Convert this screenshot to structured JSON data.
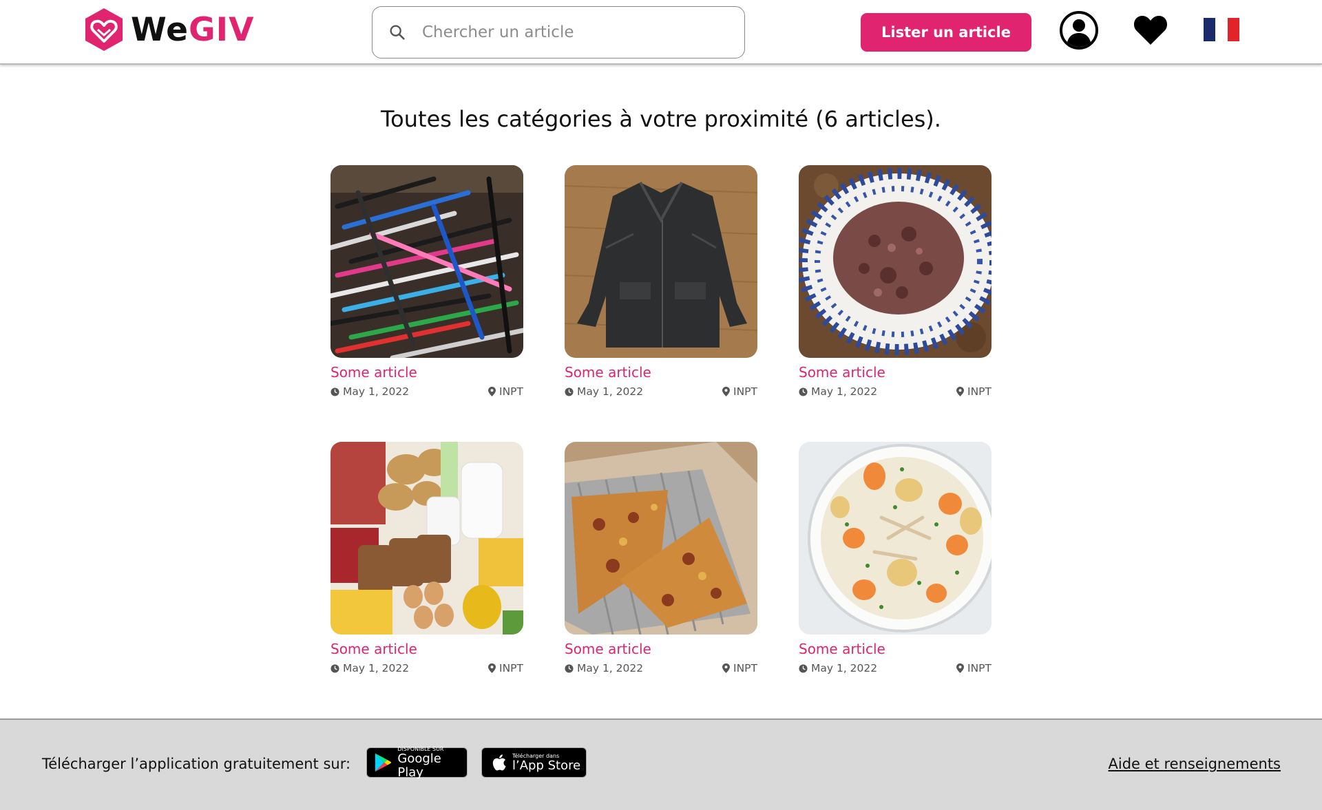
{
  "header": {
    "logo_we": "We",
    "logo_giv": "GIV",
    "search_placeholder": "Chercher un article",
    "list_button": "Lister un article"
  },
  "main": {
    "title": "Toutes les catégories à votre proximité (6 articles).",
    "articles": [
      {
        "title": "Some article",
        "date": "May 1, 2022",
        "location": "INPT",
        "image": "pens"
      },
      {
        "title": "Some article",
        "date": "May 1, 2022",
        "location": "INPT",
        "image": "leather-jacket"
      },
      {
        "title": "Some article",
        "date": "May 1, 2022",
        "location": "INPT",
        "image": "ground-meat-bowl"
      },
      {
        "title": "Some article",
        "date": "May 1, 2022",
        "location": "INPT",
        "image": "groceries"
      },
      {
        "title": "Some article",
        "date": "May 1, 2022",
        "location": "INPT",
        "image": "pizza"
      },
      {
        "title": "Some article",
        "date": "May 1, 2022",
        "location": "INPT",
        "image": "chicken-stew"
      }
    ]
  },
  "footer": {
    "download_text": "Télécharger l’application gratuitement sur:",
    "google_small": "DISPONIBLE SUR",
    "google_big": "Google Play",
    "apple_small": "Télécharger dans",
    "apple_big": "l’App Store",
    "help_link": "Aide et renseignements"
  },
  "colors": {
    "accent": "#e0246f",
    "footer_bg": "#d9d9d9",
    "flag_blue": "#1b2a6b",
    "flag_red": "#e1242a"
  }
}
